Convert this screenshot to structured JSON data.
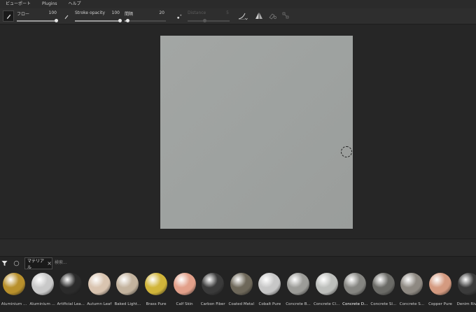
{
  "menubar": {
    "items": [
      "ビューポート",
      "Plugins",
      "ヘルプ"
    ]
  },
  "toolbar": {
    "flow": {
      "label": "フロー",
      "value": "100",
      "fraction": 1.0
    },
    "stroke_opacity": {
      "label": "Stroke opacity",
      "value": "100",
      "fraction": 1.0
    },
    "spacing": {
      "label": "間隔",
      "value": "20",
      "fraction": 0.05
    },
    "distance": {
      "label": "Distance",
      "value": "5",
      "fraction": 0.4
    }
  },
  "shelf": {
    "tab_label": "マテリアル",
    "search_placeholder": "検索..."
  },
  "materials": [
    {
      "name": "Aluminium ...",
      "color": "#b8902c"
    },
    {
      "name": "Aluminium ...",
      "color": "#c9c9c9"
    },
    {
      "name": "Artificial Lea...",
      "color": "#2b2b2b"
    },
    {
      "name": "Autumn Leaf",
      "color": "#d9c4b0"
    },
    {
      "name": "Baked Light...",
      "color": "#c3b39e"
    },
    {
      "name": "Brass Pure",
      "color": "#d1b53a"
    },
    {
      "name": "Calf Skin",
      "color": "#e2a08a"
    },
    {
      "name": "Carbon Fiber",
      "color": "#3a3a3a"
    },
    {
      "name": "Coated Metal",
      "color": "#6e685a"
    },
    {
      "name": "Cobalt Pure",
      "color": "#c7c7c7"
    },
    {
      "name": "Concrete B...",
      "color": "#9c9c98"
    },
    {
      "name": "Concrete Cl...",
      "color": "#bdbfbc"
    },
    {
      "name": "Concrete D...",
      "color": "#858581"
    },
    {
      "name": "Concrete Sl...",
      "color": "#6a6a66"
    },
    {
      "name": "Concrete S...",
      "color": "#8e8982"
    },
    {
      "name": "Copper Pure",
      "color": "#d49a80"
    },
    {
      "name": "Denim Rivet",
      "color": "#3b3b3b"
    }
  ],
  "colors": {
    "accent": "#4a9eda",
    "background": "#262626"
  }
}
